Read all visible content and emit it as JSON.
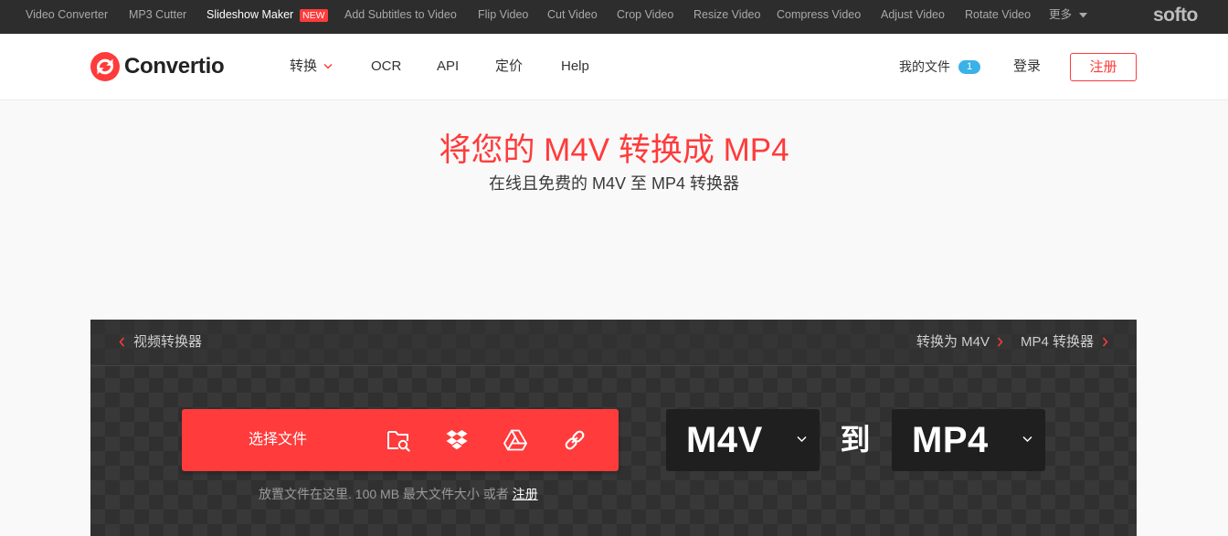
{
  "topbar": {
    "items": [
      "Video Converter",
      "MP3 Cutter",
      "Slideshow Maker",
      "Add Subtitles to Video",
      "Flip Video",
      "Cut Video",
      "Crop Video",
      "Resize Video",
      "Compress Video",
      "Adjust Video",
      "Rotate Video"
    ],
    "new_badge": "NEW",
    "more_label": "更多",
    "brand": "softo"
  },
  "header": {
    "brand": "Convertio",
    "nav": {
      "convert": "转换",
      "ocr": "OCR",
      "api": "API",
      "pricing": "定价",
      "help": "Help"
    },
    "my_files": "我的文件",
    "my_files_count": "1",
    "login": "登录",
    "register": "注册"
  },
  "hero": {
    "title": "将您的 M4V 转换成 MP4",
    "subtitle": "在线且免费的 M4V 至 MP4 转换器"
  },
  "panel": {
    "breadcrumb_back": "视频转换器",
    "links": [
      "转换为 M4V",
      "MP4 转换器"
    ],
    "choose_files": "选择文件",
    "hint": "放置文件在这里. 100 MB 最大文件大小 或者 ",
    "hint_link": "注册",
    "from_format": "M4V",
    "to_label": "到",
    "to_format": "MP4"
  },
  "icons": {
    "logo": "convertio-logo-icon",
    "sources": [
      "folder-search-icon",
      "dropbox-icon",
      "google-drive-icon",
      "link-icon"
    ],
    "dropdown": "chevron-down-icon",
    "breadcrumb_back": "chevron-left-icon",
    "breadcrumb_forward": "chevron-right-icon"
  },
  "colors": {
    "accent": "#ff3b3b",
    "topbar_bg": "#2d2d2d",
    "panel_bg": "#333333",
    "format_box_bg": "#1f1f1f",
    "badge_blue": "#3ab1e8",
    "page_bg": "#f9f9f9"
  }
}
